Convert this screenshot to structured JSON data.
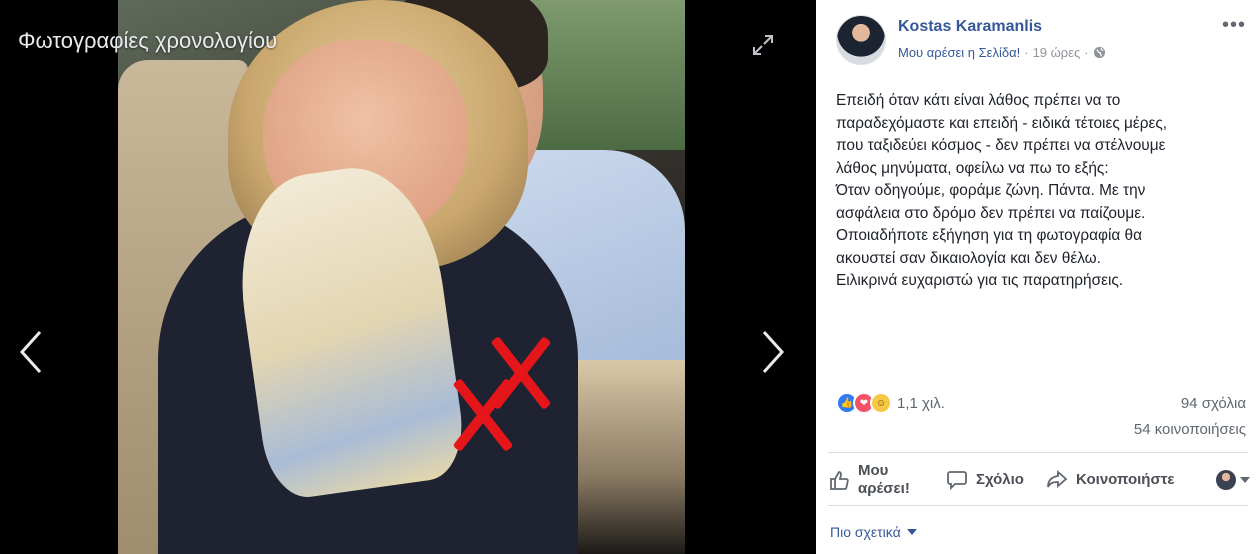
{
  "viewer": {
    "title": "Φωτογραφίες χρονολογίου"
  },
  "post": {
    "author": "Kostas Karamanlis",
    "like_page": "Μου αρέσει η Σελίδα!",
    "separator": "·",
    "time": "19 ώρες",
    "more": "•••",
    "text_lines": [
      "Επειδή όταν κάτι είναι λάθος πρέπει να το",
      "παραδεχόμαστε και επειδή - ειδικά τέτοιες μέρες,",
      "που ταξιδεύει κόσμος - δεν πρέπει να στέλνουμε",
      "λάθος μηνύματα, οφείλω να πω το εξής:",
      "Όταν οδηγούμε, φοράμε ζώνη. Πάντα. Με την",
      "ασφάλεια στο δρόμο δεν πρέπει να παίζουμε.",
      "Οποιαδήποτε εξήγηση για τη φωτογραφία θα",
      "ακουστεί σαν δικαιολογία και δεν θέλω.",
      "Ειλικρινά ευχαριστώ για τις παρατηρήσεις."
    ],
    "reactions_count": "1,1 χιλ.",
    "comments": "94 σχόλια",
    "shares": "54 κοινοποιήσεις"
  },
  "actions": {
    "like_line1": "Μου",
    "like_line2": "αρέσει!",
    "comment": "Σχόλιο",
    "share": "Κοινοποιήστε"
  },
  "related": "Πιο σχετικά",
  "colors": {
    "link": "#365899",
    "like_blue": "#2f7bf5",
    "love_red": "#f25268",
    "haha_yellow": "#f7c843",
    "red_x": "#e4161a"
  }
}
